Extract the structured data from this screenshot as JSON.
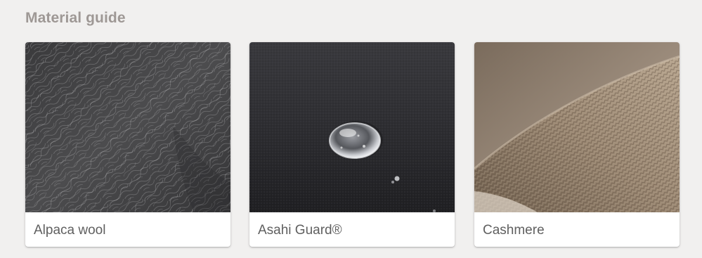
{
  "section": {
    "title": "Material guide"
  },
  "cards": [
    {
      "label": "Alpaca wool",
      "image_icon": "alpaca-wool-texture-image"
    },
    {
      "label": "Asahi Guard®",
      "image_icon": "water-drop-fabric-image"
    },
    {
      "label": "Cashmere",
      "image_icon": "cashmere-knit-image"
    }
  ]
}
